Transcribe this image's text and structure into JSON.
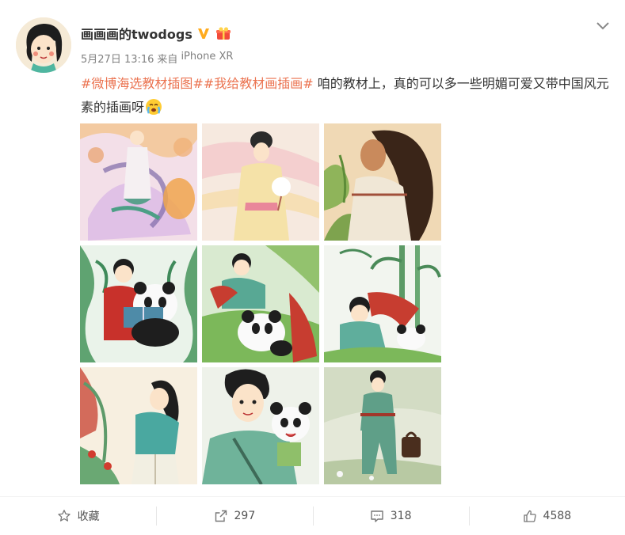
{
  "user": {
    "name": "画画画的twodogs",
    "avatar_icon": "user-avatar",
    "verified_icon": "verified-v-icon",
    "gift_icon": "member-gift-icon"
  },
  "meta": {
    "time": "5月27日 13:16",
    "source_prefix": "来自",
    "source": "iPhone XR"
  },
  "post": {
    "tag1": "#微博海选教材插图#",
    "tag2": "#我给教材画插画#",
    "text": " 咱的教材上，真的可以多一些明媚可爱又带中国风元素的插画呀",
    "emoji_icon": "crying-face-emoji"
  },
  "images": [
    {
      "icon": "illustration-dancer"
    },
    {
      "icon": "illustration-lady-fan"
    },
    {
      "icon": "illustration-long-hair"
    },
    {
      "icon": "illustration-girl-panda-reading"
    },
    {
      "icon": "illustration-girl-panda-grass"
    },
    {
      "icon": "illustration-girl-panda-bamboo"
    },
    {
      "icon": "illustration-girl-flowers"
    },
    {
      "icon": "illustration-boy-panda"
    },
    {
      "icon": "illustration-traveler"
    }
  ],
  "actions": {
    "favorite_label": "收藏",
    "repost_count": "297",
    "comment_count": "318",
    "like_count": "4588"
  },
  "colors": {
    "tag": "#eb7350",
    "verified": "#ffab1e",
    "text": "#333333",
    "meta": "#808080"
  }
}
